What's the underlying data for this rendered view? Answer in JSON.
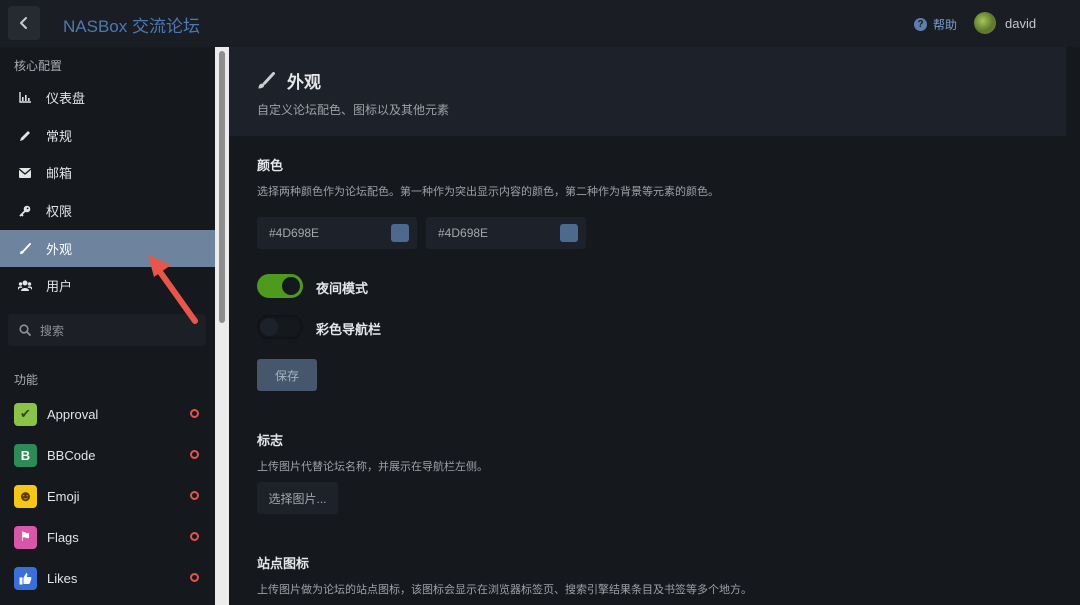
{
  "header": {
    "site_title": "NASBox 交流论坛",
    "help_label": "帮助",
    "username": "david"
  },
  "sidebar": {
    "core_section_label": "核心配置",
    "items": [
      {
        "label": "仪表盘",
        "icon": "bar-chart-icon"
      },
      {
        "label": "常规",
        "icon": "pencil-icon"
      },
      {
        "label": "邮箱",
        "icon": "envelope-icon"
      },
      {
        "label": "权限",
        "icon": "key-icon"
      },
      {
        "label": "外观",
        "icon": "paintbrush-icon",
        "active": true
      },
      {
        "label": "用户",
        "icon": "users-icon"
      }
    ],
    "search_placeholder": "搜索",
    "features_section_label": "功能",
    "plugins": [
      {
        "label": "Approval",
        "icon_color": "#8bc34a",
        "glyph": "✔"
      },
      {
        "label": "BBCode",
        "icon_color": "#2e8b57",
        "glyph": "B"
      },
      {
        "label": "Emoji",
        "icon_color": "#f5c518",
        "glyph": "☻"
      },
      {
        "label": "Flags",
        "icon_color": "#d957a8",
        "glyph": "⚑"
      },
      {
        "label": "Likes",
        "icon_color": "#3b6fd8",
        "glyph": "👍"
      }
    ]
  },
  "main": {
    "title": "外观",
    "description": "自定义论坛配色、图标以及其他元素",
    "colors": {
      "heading": "颜色",
      "description": "选择两种颜色作为论坛配色。第一种作为突出显示内容的颜色，第二种作为背景等元素的颜色。",
      "primary_value": "#4D698E",
      "secondary_value": "#4D698E"
    },
    "dark_mode_label": "夜间模式",
    "dark_mode_on": true,
    "colored_header_label": "彩色导航栏",
    "colored_header_on": false,
    "save_label": "保存",
    "logo": {
      "heading": "标志",
      "description": "上传图片代替论坛名称，并展示在导航栏左侧。",
      "button_label": "选择图片..."
    },
    "favicon": {
      "heading": "站点图标",
      "description": "上传图片做为论坛的站点图标，该图标会显示在浏览器标签页、搜索引擎结果条目及书签等多个地方。"
    }
  },
  "colors": {
    "accent": "#4D698E",
    "active_nav_bg": "#6d839e",
    "toggle_on": "#4e9a1e",
    "annotation_arrow": "#e8554a"
  }
}
